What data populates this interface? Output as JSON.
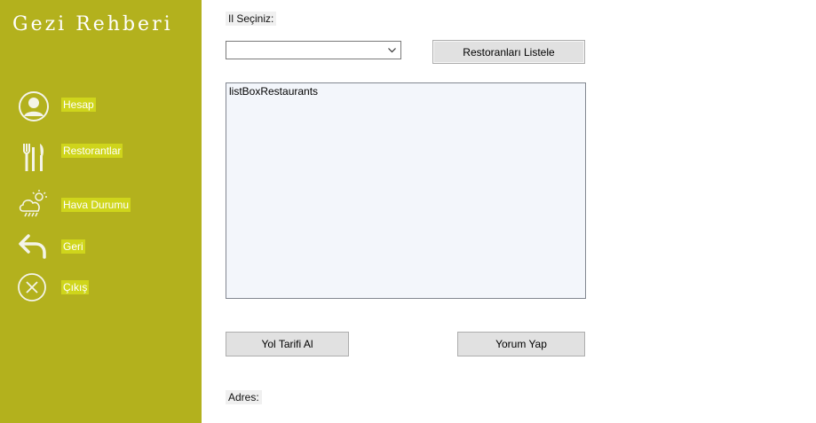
{
  "app": {
    "title": "Gezi Rehberi"
  },
  "sidebar": {
    "items": [
      {
        "label": "Hesap",
        "icon": "account-icon"
      },
      {
        "label": "Restorantlar",
        "icon": "fork-knife-icon"
      },
      {
        "label": "Hava Durumu",
        "icon": "weather-icon"
      },
      {
        "label": "Geri",
        "icon": "back-arrow-icon"
      },
      {
        "label": "Çıkış",
        "icon": "close-circle-icon"
      }
    ]
  },
  "main": {
    "city_label": "Il Seçiniz:",
    "city_select_value": "",
    "list_button": "Restoranları Listele",
    "listbox_text": "listBoxRestaurants",
    "directions_button": "Yol Tarifi Al",
    "comment_button": "Yorum Yap",
    "address_label": "Adres:"
  },
  "colors": {
    "sidebar_bg": "#b3b11d",
    "nav_label_highlight": "#cfd51b",
    "listbox_bg": "#f3f6fb",
    "button_bg": "#e1e1e1"
  }
}
